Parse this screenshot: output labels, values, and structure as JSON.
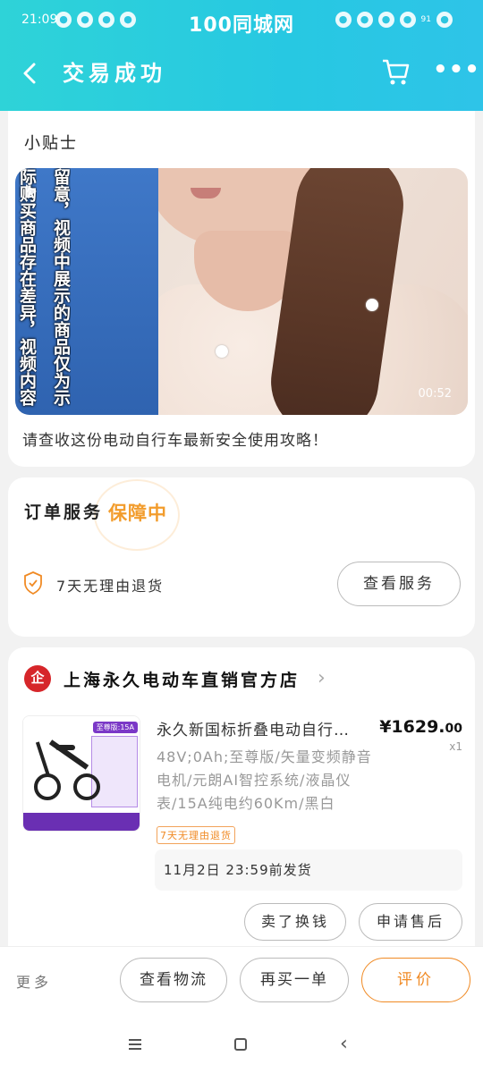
{
  "status_bar": {
    "time": "21:09",
    "brand": "100同城网",
    "signal_text": "91"
  },
  "nav": {
    "title": "交易成功",
    "back_icon": "back-arrow-icon",
    "cart_icon": "cart-icon",
    "more_icon": "more-dots-icon",
    "more_label": "•••"
  },
  "tips": {
    "title": "小贴士",
    "video_subtitle_col1": "际购买商品存在差异，视频内容",
    "video_subtitle_col2": "留意，视频中展示的商品仅为示",
    "video_duration": "00:52",
    "description": "请查收这份电动自行车最新安全使用攻略！"
  },
  "guarantee": {
    "title": "订单服务",
    "badge": "保障中",
    "item": "7天无理由退货",
    "view_button": "查看服务"
  },
  "order": {
    "shop_name": "上海永久电动车直销官方店",
    "shop_logo_text": "企",
    "product_title": "永久新国标折叠电动自行…",
    "product_spec": "48V;0Ah;至尊版/矢量变频静音电机/元朗AI智控系统/液晶仪表/15A纯电约60Km/黑白",
    "image_badge": "至尊版:15A",
    "price_big": "¥1629.",
    "price_small": "00",
    "quantity": "x1",
    "tag": "7天无理由退货",
    "shipping": "11月2日 23:59前发货",
    "exchange_button": "卖了换钱",
    "aftersale_button": "申请售后"
  },
  "bottom": {
    "more": "更多",
    "logistics_button": "查看物流",
    "rebuy_button": "再买一单",
    "review_button": "评价"
  },
  "colors": {
    "header_gradient_start": "#2ed3d8",
    "header_gradient_end": "#2ec4e8",
    "accent_orange": "#f08a24",
    "shop_red": "#d6262a"
  }
}
